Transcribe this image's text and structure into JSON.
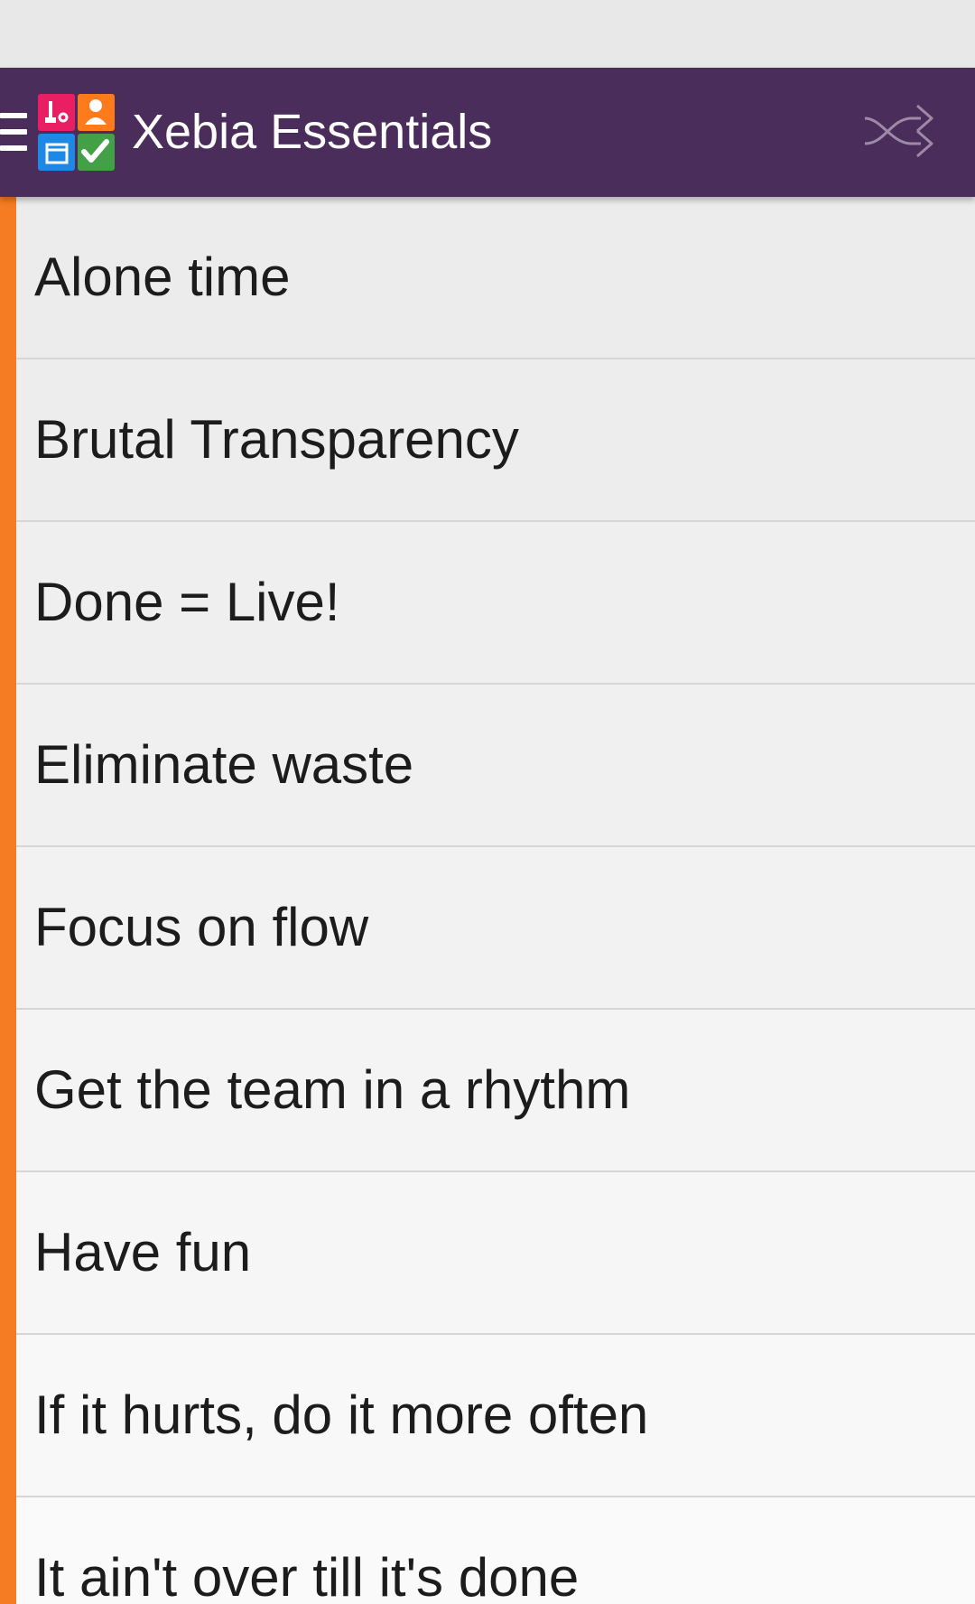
{
  "app_bar": {
    "title": "Xebia Essentials",
    "background_color": "#4b2d5c",
    "nav_icon": "menu-icon",
    "action_icon": "shuffle-icon",
    "logo_colors": [
      "#e91e63",
      "#ff7a1a",
      "#1e88e5",
      "#43a047"
    ]
  },
  "list": {
    "accent_color": "#f57c22",
    "items": [
      {
        "label": "Alone time"
      },
      {
        "label": "Brutal Transparency"
      },
      {
        "label": "Done = Live!"
      },
      {
        "label": "Eliminate waste"
      },
      {
        "label": "Focus on flow"
      },
      {
        "label": "Get the team in a rhythm"
      },
      {
        "label": "Have fun"
      },
      {
        "label": "If it hurts, do it more often"
      },
      {
        "label": "It ain't over till it's done"
      }
    ]
  }
}
